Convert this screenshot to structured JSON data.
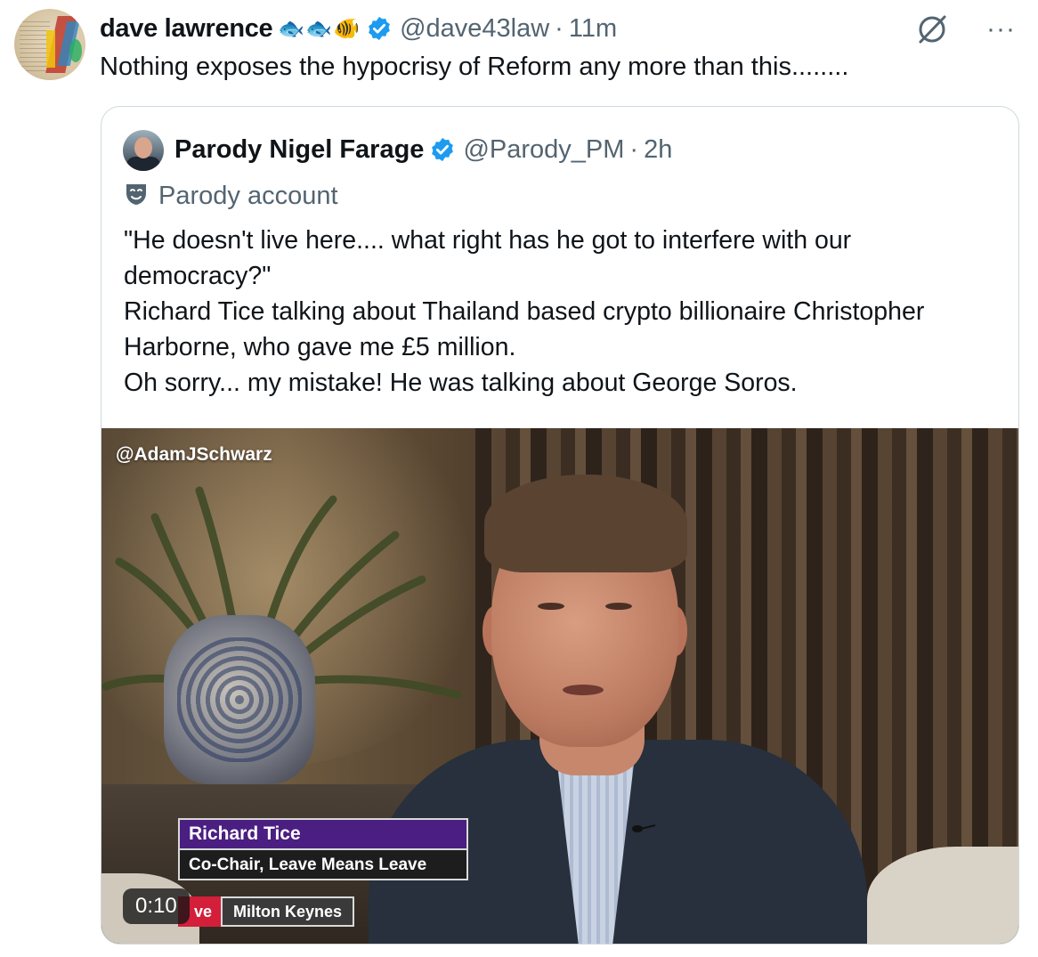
{
  "post": {
    "author_name": "dave lawrence",
    "badges": [
      "🐟",
      "🐟",
      "🐠"
    ],
    "handle": "@dave43law",
    "separator": "·",
    "time": "11m",
    "text": "Nothing exposes the hypocrisy of Reform any more than this........"
  },
  "actions": {
    "grok_icon": "grok-icon",
    "more_label": "···"
  },
  "quote": {
    "author_name": "Parody Nigel Farage",
    "handle": "@Parody_PM",
    "separator": "·",
    "time": "2h",
    "parody_label": "Parody account",
    "lines": [
      "\"He doesn't live here.... what right has he got to interfere with our",
      "democracy?\"",
      "Richard Tice talking about Thailand based crypto billionaire Christopher",
      "Harborne, who gave me £5 million.",
      "Oh sorry... my mistake! He was talking about George Soros."
    ]
  },
  "video": {
    "watermark": "@AdamJSchwarz",
    "lower_third_name": "Richard Tice",
    "lower_third_role": "Co-Chair, Leave Means Leave",
    "live_tag": "ve",
    "location": "Milton Keynes",
    "duration": "0:10"
  },
  "colors": {
    "verified_blue": "#1d9bf0",
    "secondary_text": "#536471",
    "border": "#cfd9de",
    "lower_third_purple": "#4b1e82"
  }
}
